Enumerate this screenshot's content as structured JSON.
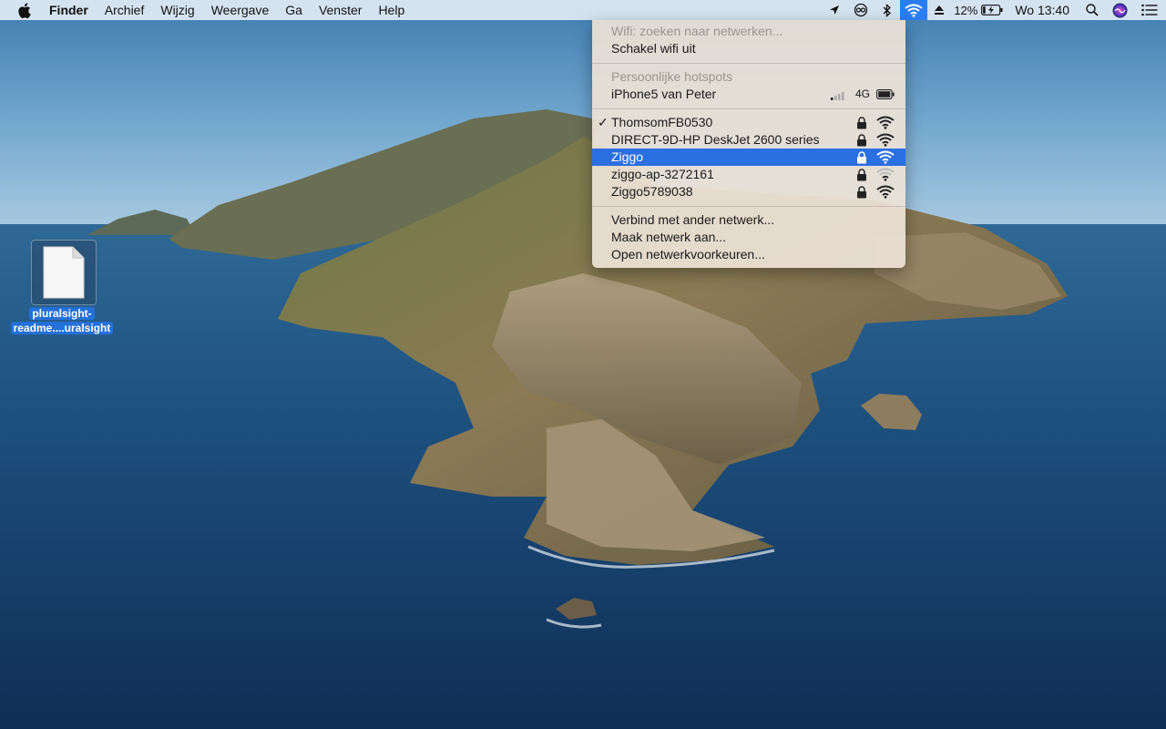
{
  "menubar": {
    "app_name": "Finder",
    "menus": [
      "Archief",
      "Wijzig",
      "Weergave",
      "Ga",
      "Venster",
      "Help"
    ],
    "battery_percent": "12%",
    "clock": "Wo 13:40",
    "icons": [
      "apple-icon",
      "location-icon",
      "screen-recording-icon",
      "bluetooth-icon",
      "wifi-icon",
      "eject-icon",
      "battery-charging-icon",
      "spotlight-icon",
      "siri-icon",
      "notification-center-icon"
    ]
  },
  "wifi_menu": {
    "status": "Wifi: zoeken naar netwerken...",
    "toggle": "Schakel wifi uit",
    "hotspots_header": "Persoonlijke hotspots",
    "hotspot": {
      "name": "iPhone5 van Peter",
      "network_type": "4G"
    },
    "networks": [
      {
        "name": "ThomsomFB0530",
        "connected": true,
        "secure": true,
        "signal": "strong"
      },
      {
        "name": "DIRECT-9D-HP DeskJet 2600 series",
        "connected": false,
        "secure": true,
        "signal": "strong"
      },
      {
        "name": "Ziggo",
        "connected": false,
        "secure": true,
        "signal": "strong",
        "highlighted": true
      },
      {
        "name": "ziggo-ap-3272161",
        "connected": false,
        "secure": true,
        "signal": "weak"
      },
      {
        "name": "Ziggo5789038",
        "connected": false,
        "secure": true,
        "signal": "strong"
      }
    ],
    "actions": [
      "Verbind met ander netwerk...",
      "Maak netwerk aan...",
      "Open netwerkvoorkeuren..."
    ]
  },
  "desktop": {
    "file_label_line1": "pluralsight-",
    "file_label_line2": "readme....uralsight"
  },
  "colors": {
    "menubar_bg": "#e2ecf6",
    "highlight": "#2b6fe0",
    "wifi_icon_active": "#2a7df2",
    "menu_bg": "#ece2d6"
  }
}
